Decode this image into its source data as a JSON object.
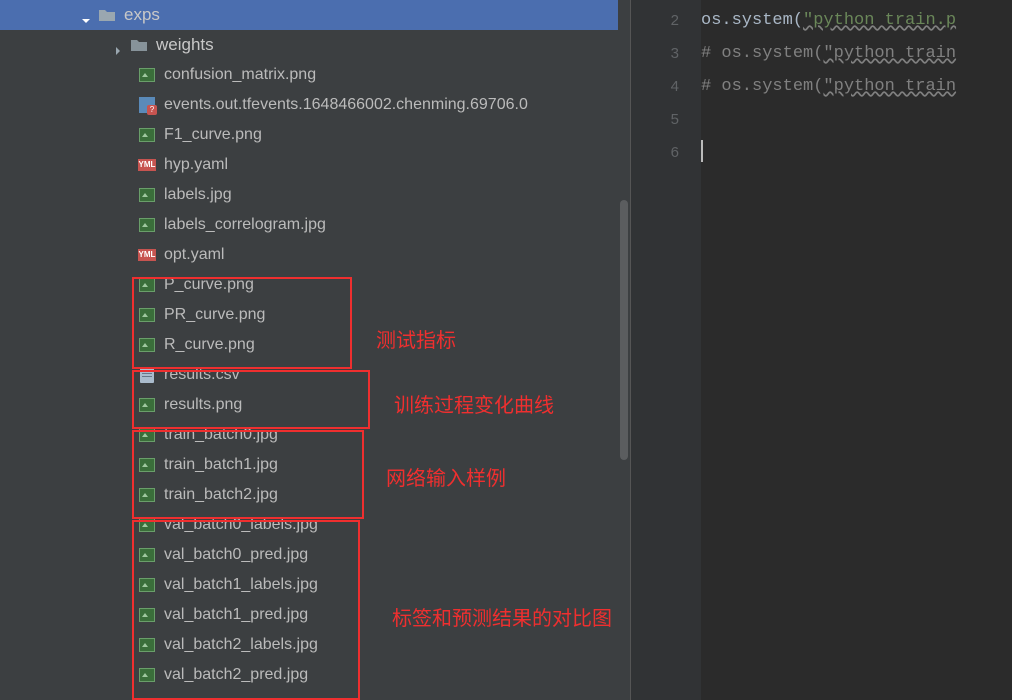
{
  "tree": {
    "folder_exps": "exps",
    "folder_weights": "weights",
    "files": {
      "confusion_matrix": "confusion_matrix.png",
      "events": "events.out.tfevents.1648466002.chenming.69706.0",
      "f1_curve": "F1_curve.png",
      "hyp_yaml": "hyp.yaml",
      "labels_jpg": "labels.jpg",
      "labels_correlogram": "labels_correlogram.jpg",
      "opt_yaml": "opt.yaml",
      "p_curve": "P_curve.png",
      "pr_curve": "PR_curve.png",
      "r_curve": "R_curve.png",
      "results_csv": "results.csv",
      "results_png": "results.png",
      "train_batch0": "train_batch0.jpg",
      "train_batch1": "train_batch1.jpg",
      "train_batch2": "train_batch2.jpg",
      "val_batch0_labels": "val_batch0_labels.jpg",
      "val_batch0_pred": "val_batch0_pred.jpg",
      "val_batch1_labels": "val_batch1_labels.jpg",
      "val_batch1_pred": "val_batch1_pred.jpg",
      "val_batch2_labels": "val_batch2_labels.jpg",
      "val_batch2_pred": "val_batch2_pred.jpg"
    }
  },
  "editor": {
    "line2": {
      "ident": "os",
      "dot": ".",
      "fn": "system(",
      "str": "\"python train.p"
    },
    "line3": {
      "cmt": "# os.system(",
      "str": "\"python train"
    },
    "line4": {
      "cmt": "# os.system(",
      "str": "\"python train"
    },
    "gutter": {
      "n2": "2",
      "n3": "3",
      "n4": "4",
      "n5": "5",
      "n6": "6"
    }
  },
  "annotations": {
    "metrics": "测试指标",
    "training_curve": "训练过程变化曲线",
    "input_samples": "网络输入样例",
    "val_compare": "标签和预测结果的对比图"
  }
}
